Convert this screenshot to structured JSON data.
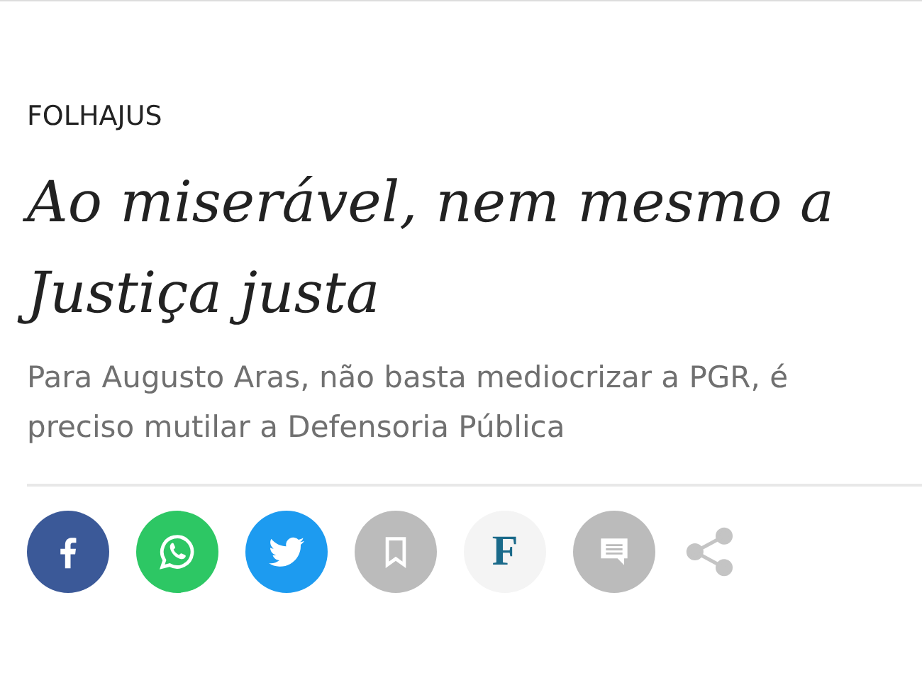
{
  "section": "FOLHAJUS",
  "headline": "Ao miserável, nem mesmo a Justiça justa",
  "subtitle": "Para Augusto Aras, não basta mediocrizar a PGR, é preciso mutilar a Defensoria Pública",
  "share_buttons": [
    {
      "kind": "facebook"
    },
    {
      "kind": "whatsapp"
    },
    {
      "kind": "twitter"
    },
    {
      "kind": "bookmark"
    },
    {
      "kind": "folha",
      "label": "F"
    },
    {
      "kind": "comment"
    },
    {
      "kind": "share"
    }
  ]
}
